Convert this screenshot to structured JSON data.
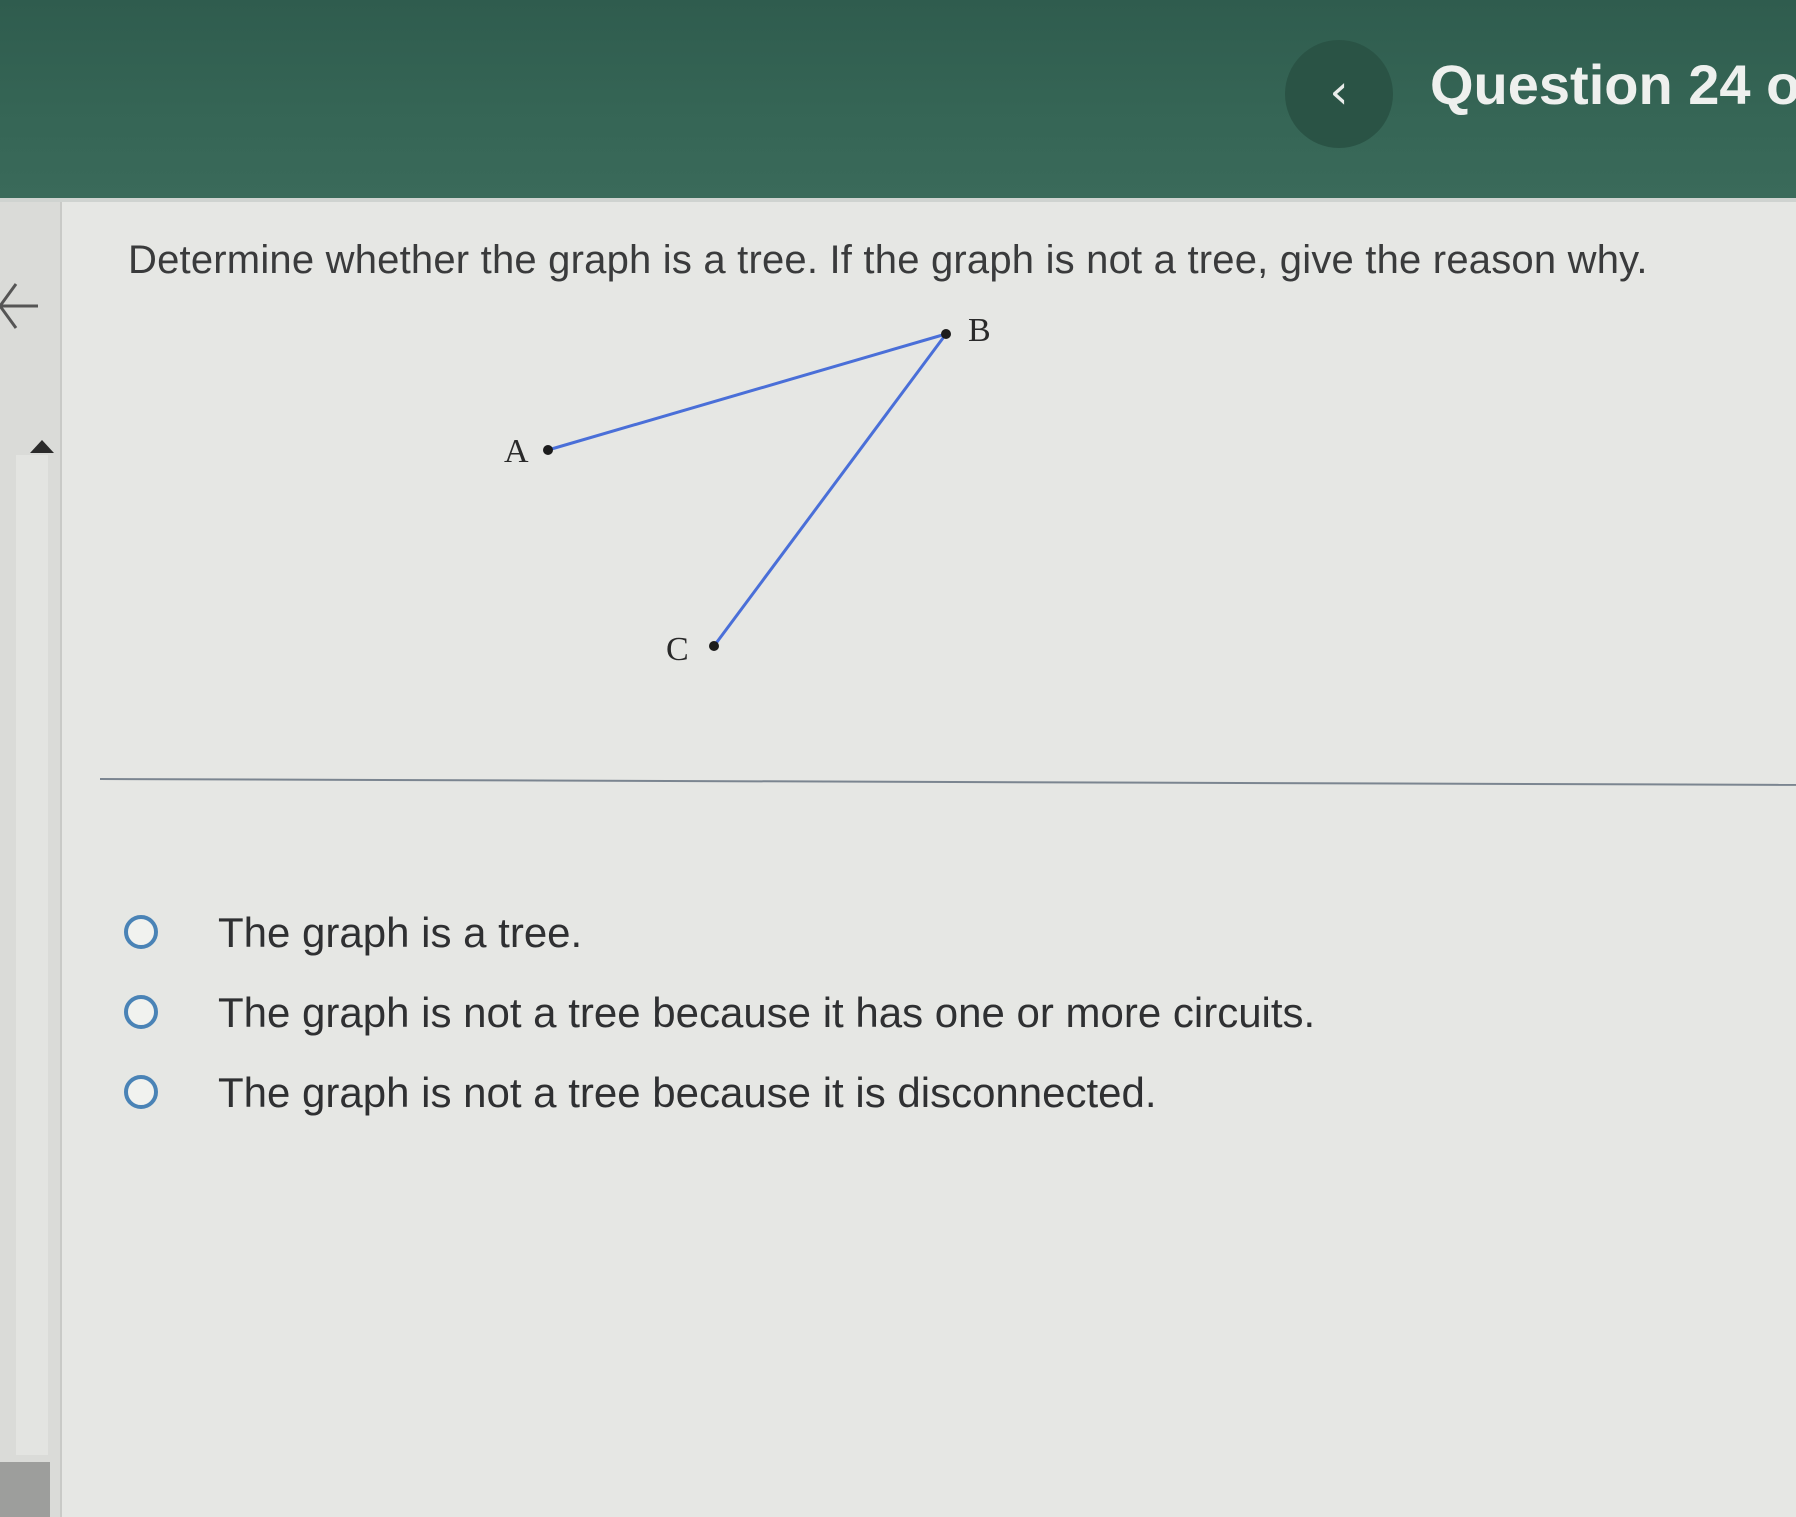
{
  "header": {
    "back_icon": "chevron-left-icon",
    "back_glyph": "‹",
    "question_counter": "Question 24 o"
  },
  "question": {
    "prompt": "Determine whether the graph is a tree. If the graph is not a tree, give the reason why."
  },
  "graph": {
    "vertices": [
      {
        "label": "A"
      },
      {
        "label": "B"
      },
      {
        "label": "C"
      }
    ],
    "edges": [
      {
        "from": "A",
        "to": "B"
      },
      {
        "from": "B",
        "to": "C"
      }
    ],
    "edge_color": "#4a6fd8"
  },
  "options": [
    {
      "label": "The graph is a tree."
    },
    {
      "label": "The graph is not a tree because it has one or more circuits."
    },
    {
      "label": "The graph is not a tree because it is disconnected."
    }
  ],
  "colors": {
    "header_bg": "#356555",
    "radio_border": "#4a83b6"
  }
}
